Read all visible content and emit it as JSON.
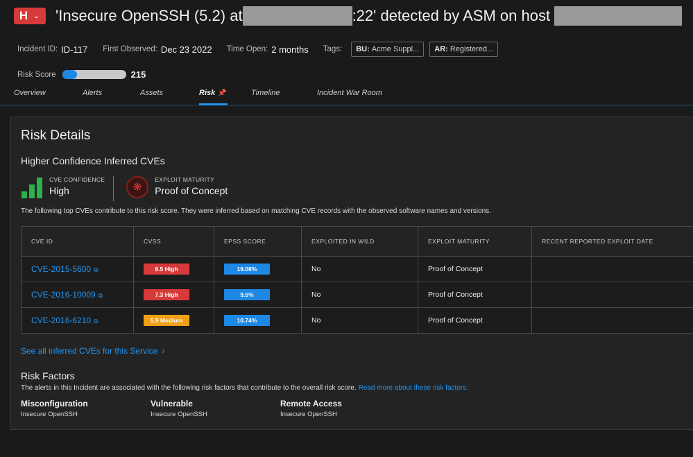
{
  "header": {
    "severity_letter": "H",
    "title_part1": "'Insecure OpenSSH (5.2) at",
    "title_part2": ":22' detected by ASM on host",
    "incident_id_label": "Incident ID:",
    "incident_id": "ID-117",
    "first_observed_label": "First Observed:",
    "first_observed": "Dec 23 2022",
    "time_open_label": "Time Open:",
    "time_open": "2 months",
    "tags_label": "Tags:",
    "tags": [
      {
        "key": "BU:",
        "value": "Acme Suppl..."
      },
      {
        "key": "AR:",
        "value": "Registered..."
      }
    ],
    "risk_score_label": "Risk Score",
    "risk_score": "215",
    "risk_score_fraction": 0.23
  },
  "tabs": [
    {
      "label": "Overview"
    },
    {
      "label": "Alerts"
    },
    {
      "label": "Assets"
    },
    {
      "label": "Risk"
    },
    {
      "label": "Timeline"
    },
    {
      "label": "Incident War Room"
    }
  ],
  "risk_details": {
    "heading": "Risk Details",
    "subheading": "Higher Confidence Inferred CVEs",
    "cve_confidence_label": "CVE CONFIDENCE",
    "cve_confidence_value": "High",
    "exploit_maturity_label": "EXPLOIT MATURITY",
    "exploit_maturity_value": "Proof of Concept",
    "description": "The following top CVEs contribute to this risk score. They were inferred based on matching CVE records with the observed software names and versions.",
    "table": {
      "columns": [
        "CVE ID",
        "CVSS",
        "EPSS SCORE",
        "EXPLOITED IN WILD",
        "EXPLOIT MATURITY",
        "RECENT REPORTED EXPLOIT DATE"
      ],
      "rows": [
        {
          "cve": "CVE-2015-5600",
          "cvss": "8.5 High",
          "cvss_level": "high",
          "epss": "19.08%",
          "wild": "No",
          "maturity": "Proof of Concept",
          "date": ""
        },
        {
          "cve": "CVE-2016-10009",
          "cvss": "7.3 High",
          "cvss_level": "high",
          "epss": "9.5%",
          "wild": "No",
          "maturity": "Proof of Concept",
          "date": ""
        },
        {
          "cve": "CVE-2016-6210",
          "cvss": "5.9 Medium",
          "cvss_level": "medium",
          "epss": "10.74%",
          "wild": "No",
          "maturity": "Proof of Concept",
          "date": ""
        }
      ]
    },
    "see_all_link": "See all inferred CVEs for this Service"
  },
  "risk_factors": {
    "heading": "Risk Factors",
    "description": "The alerts in this Incident are associated with the following risk factors that contribute to the overall risk score.",
    "read_more_link": "Read more about these risk factors.",
    "items": [
      {
        "name": "Misconfiguration",
        "detail": "Insecure OpenSSH"
      },
      {
        "name": "Vulnerable",
        "detail": "Insecure OpenSSH"
      },
      {
        "name": "Remote Access",
        "detail": "Insecure OpenSSH"
      }
    ]
  },
  "colors": {
    "background": "#1a1a1a",
    "panel": "#232323",
    "accent_blue": "#2196f3",
    "severity_high": "#d63a3a",
    "severity_medium": "#f0a014",
    "confidence_green": "#2bb24c"
  }
}
